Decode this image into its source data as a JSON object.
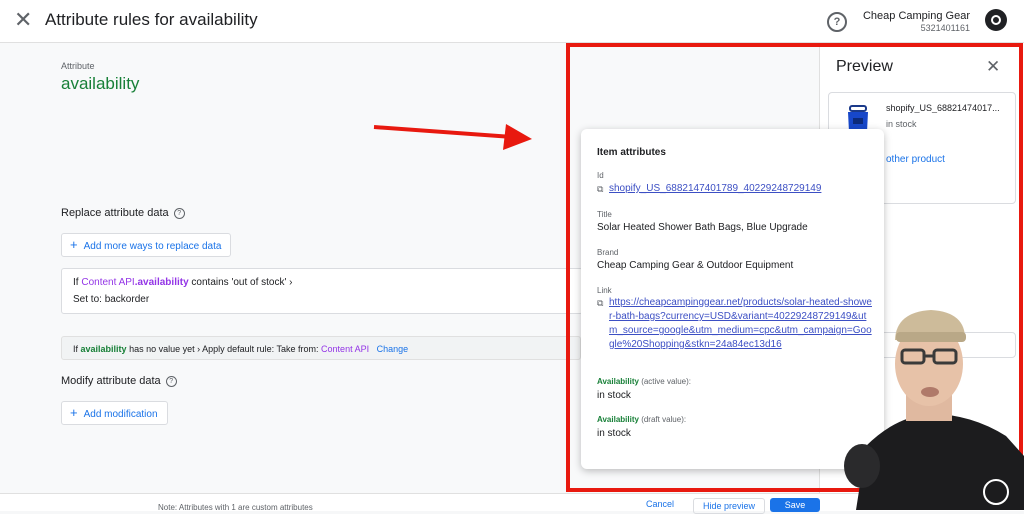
{
  "header": {
    "title": "Attribute rules for availability",
    "account_name": "Cheap Camping Gear",
    "account_id": "5321401161",
    "help_icon": "help-circle-icon",
    "close_icon": "close-icon"
  },
  "attribute": {
    "label": "Attribute",
    "value": "availability"
  },
  "replace_section": {
    "title": "Replace attribute data",
    "add_button": "Add more ways to replace data",
    "rule": {
      "prefix": "If",
      "source": "Content API",
      "dot": ".",
      "field": "availability",
      "condition": "contains 'out of stock' ›",
      "set_label": "Set to:",
      "set_value": "backorder"
    },
    "default": {
      "prefix": "If",
      "field": "availability",
      "text": "has no value yet › Apply default rule: Take from:",
      "source": "Content API",
      "change_link": "Change"
    }
  },
  "modify_section": {
    "title": "Modify attribute data",
    "add_button": "Add modification"
  },
  "footer": {
    "note": "Note: Attributes with 1 are custom attributes",
    "cancel": "Cancel",
    "hide_preview": "Hide preview",
    "save": "Save"
  },
  "preview": {
    "title": "Preview",
    "product_name": "shopify_US_68821474017...",
    "product_status": "in stock",
    "other_product": "other product"
  },
  "item_attributes": {
    "heading": "Item attributes",
    "id_label": "Id",
    "id_value": "shopify_US_6882147401789_40229248729149",
    "title_label": "Title",
    "title_value": "Solar Heated Shower Bath Bags, Blue Upgrade",
    "brand_label": "Brand",
    "brand_value": "Cheap Camping Gear & Outdoor Equipment",
    "link_label": "Link",
    "link_value": "https://cheapcampinggear.net/products/solar-heated-shower-bath-bags?currency=USD&variant=40229248729149&utm_source=google&utm_medium=cpc&utm_campaign=Google%20Shopping&stkn=24a84ec13d16",
    "avail_active_label": "Availability",
    "avail_active_suffix": "(active value):",
    "avail_active_value": "in stock",
    "avail_draft_label": "Availability",
    "avail_draft_suffix": "(draft value):",
    "avail_draft_value": "in stock"
  },
  "colors": {
    "accent": "#1a73e8",
    "green": "#188038",
    "purple": "#9334e6",
    "highlight_frame": "#e8190f"
  }
}
